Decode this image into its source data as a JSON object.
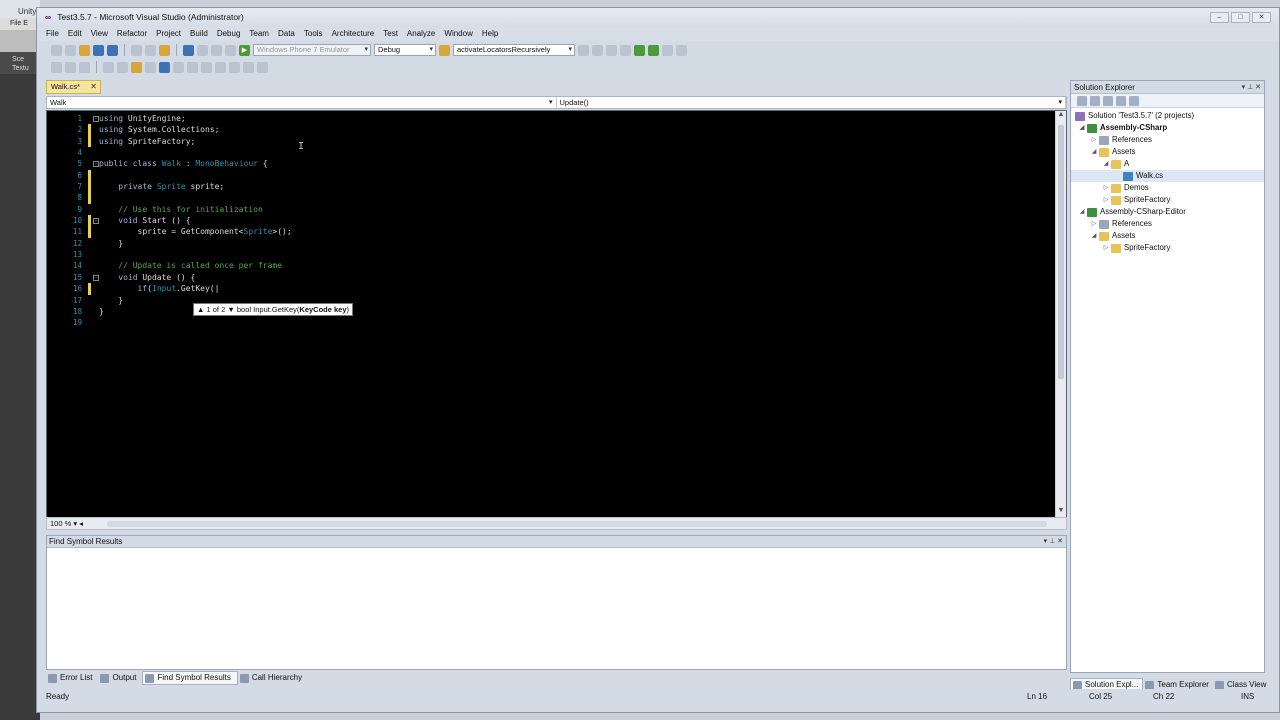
{
  "background_app": {
    "title": "Unity",
    "menu_file": "File",
    "menu_edit": "E",
    "scene_label": "Sce",
    "textures_label": "Textu"
  },
  "window": {
    "title": "Test3.5.7 - Microsoft Visual Studio (Administrator)"
  },
  "menu": [
    "File",
    "Edit",
    "View",
    "Refactor",
    "Project",
    "Build",
    "Debug",
    "Team",
    "Data",
    "Tools",
    "Architecture",
    "Test",
    "Analyze",
    "Window",
    "Help"
  ],
  "toolbar": {
    "target_device": "Windows Phone 7 Emulator",
    "configuration": "Debug",
    "find_combo": "activateLocatorsRecursively"
  },
  "document_tab": {
    "label": "Walk.cs*"
  },
  "navbar": {
    "type_dropdown": "Walk",
    "member_dropdown": "Update()"
  },
  "editor": {
    "line_numbers": [
      "1",
      "2",
      "3",
      "4",
      "5",
      "6",
      "7",
      "8",
      "9",
      "10",
      "11",
      "12",
      "13",
      "14",
      "15",
      "16",
      "17",
      "18",
      "19"
    ],
    "tooltip": {
      "counter": "▲ 1 of 2 ▼",
      "signature": "bool Input.GetKey(",
      "param": "KeyCode key",
      "close": ")"
    },
    "zoom": "100 %"
  },
  "find_panel": {
    "title": "Find Symbol Results"
  },
  "bottom_tabs": [
    "Error List",
    "Output",
    "Find Symbol Results",
    "Call Hierarchy"
  ],
  "solution_explorer": {
    "title": "Solution Explorer",
    "tree": [
      {
        "label": "Solution 'Test3.5.7' (2 projects)"
      },
      {
        "label": "Assembly-CSharp"
      },
      {
        "label": "References"
      },
      {
        "label": "Assets"
      },
      {
        "label": "A"
      },
      {
        "label": "Walk.cs"
      },
      {
        "label": "Demos"
      },
      {
        "label": "SpriteFactory"
      },
      {
        "label": "Assembly-CSharp-Editor"
      },
      {
        "label": "References"
      },
      {
        "label": "Assets"
      },
      {
        "label": "SpriteFactory"
      }
    ],
    "tabs": [
      "Solution Expl...",
      "Team Explorer",
      "Class View"
    ]
  },
  "status": {
    "ready": "Ready",
    "ln": "Ln 16",
    "col": "Col 25",
    "ch": "Ch 22",
    "mode": "INS"
  }
}
